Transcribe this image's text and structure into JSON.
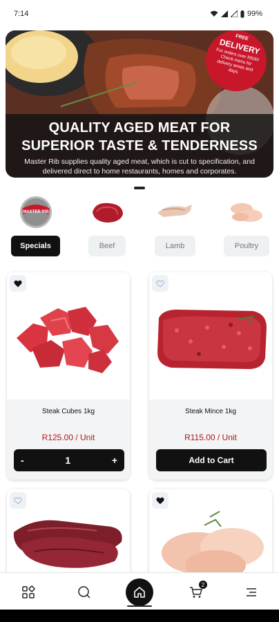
{
  "status_bar": {
    "time": "7:14",
    "battery": "99%"
  },
  "banner": {
    "title": "QUALITY AGED MEAT FOR SUPERIOR TASTE & TENDERNESS",
    "subtitle": "Master Rib supplies quality aged meat, which is cut to specification, and delivered direct to home restaurants, homes and corporates.",
    "badge_top": "FREE",
    "badge_main": "DELIVERY",
    "badge_text": "For orders over R500! Check menu for delivery areas and days."
  },
  "categories": {
    "logo_text": "MASTER RIB",
    "tabs": [
      {
        "label": "Specials",
        "active": true
      },
      {
        "label": "Beef",
        "active": false
      },
      {
        "label": "Lamb",
        "active": false
      },
      {
        "label": "Poultry",
        "active": false
      }
    ]
  },
  "products": [
    {
      "name": "Steak Cubes 1kg",
      "price": "R125.00 / Unit",
      "favorite": true,
      "qty": "1",
      "minus": "-",
      "plus": "+"
    },
    {
      "name": "Steak Mince 1kg",
      "price": "R115.00 / Unit",
      "favorite": false,
      "button": "Add to Cart"
    },
    {
      "name": "",
      "favorite": false
    },
    {
      "name": "",
      "favorite": true
    }
  ],
  "bottom_nav": {
    "items": [
      "categories-icon",
      "search-icon",
      "home-icon",
      "cart-icon",
      "menu-icon"
    ],
    "cart_count": "2"
  },
  "colors": {
    "accent": "#111111",
    "price": "#b0161e",
    "badge": "#c8162b"
  }
}
